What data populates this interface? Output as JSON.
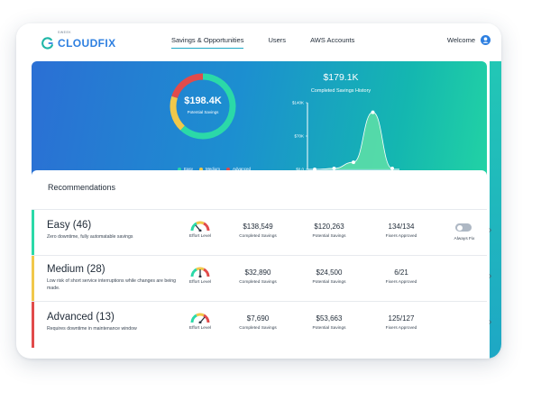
{
  "brand": {
    "small": "SWEEK",
    "name": "CLOUDFIX"
  },
  "nav": [
    "Savings & Opportunities",
    "Users",
    "AWS Accounts"
  ],
  "welcome": "Welcome",
  "summary": {
    "potential_value": "$198.4K",
    "potential_label": "Potential Savings",
    "legend": [
      {
        "label": "Easy",
        "color": "#2bd9a8"
      },
      {
        "label": "Medium",
        "color": "#f1c84b"
      },
      {
        "label": "Advanced",
        "color": "#e14b4b"
      }
    ],
    "ring_shares": [
      0.62,
      0.18,
      0.2
    ]
  },
  "history": {
    "value": "$179.1K",
    "title": "Completed Savings History",
    "y_ticks": [
      "$140K",
      "$70K",
      "$0.0"
    ],
    "months": [
      "Jun",
      "July",
      "Aug",
      "Sep",
      "Oct"
    ]
  },
  "chart_data": {
    "type": "area",
    "x": [
      "Jun",
      "July",
      "Aug",
      "Sep",
      "Oct"
    ],
    "values": [
      0,
      2,
      15,
      120,
      2
    ],
    "ylim": [
      0,
      140
    ],
    "title": "Completed Savings History",
    "ylabel": ""
  },
  "recommendations": {
    "title": "Recommendations",
    "rows": [
      {
        "name": "Easy (46)",
        "desc": "Zero downtime, fully automatable savings",
        "color": "#2bd9a8",
        "effort_label": "Effort Level",
        "completed": "$138,549",
        "completed_label": "Completed Savings",
        "potential": "$120,263",
        "potential_label": "Potential Savings",
        "fixers": "134/134",
        "fixers_label": "Fixers Approved",
        "always_fix_label": "Always Fix"
      },
      {
        "name": "Medium (28)",
        "desc": "Low risk of short service interruptions while changes are being made.",
        "color": "#f1c84b",
        "effort_label": "Effort Level",
        "completed": "$32,890",
        "completed_label": "Completed Savings",
        "potential": "$24,500",
        "potential_label": "Potential Savings",
        "fixers": "6/21",
        "fixers_label": "Fixers Approved"
      },
      {
        "name": "Advanced (13)",
        "desc": "Requires downtime in maintenance window",
        "color": "#e14b4b",
        "effort_label": "Effort Level",
        "completed": "$7,690",
        "completed_label": "Completed Savings",
        "potential": "$53,663",
        "potential_label": "Potential Savings",
        "fixers": "125/127",
        "fixers_label": "Fixers Approved"
      }
    ]
  }
}
